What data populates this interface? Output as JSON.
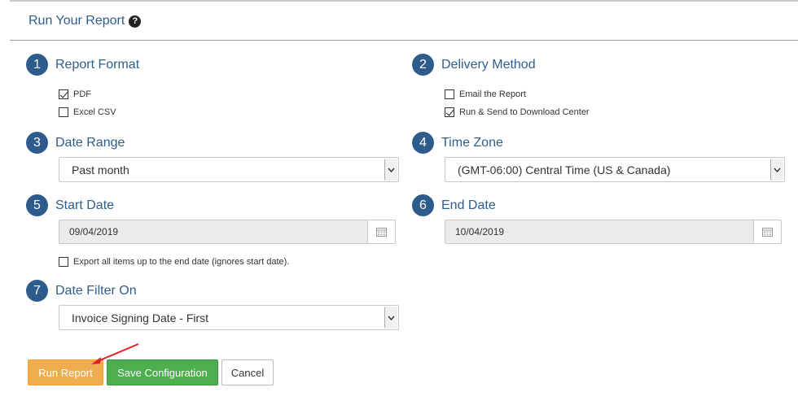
{
  "header": {
    "title": "Run Your Report",
    "help_icon": "question-circle-icon"
  },
  "steps": {
    "s1": {
      "num": "1",
      "title": "Report Format"
    },
    "s2": {
      "num": "2",
      "title": "Delivery Method"
    },
    "s3": {
      "num": "3",
      "title": "Date Range"
    },
    "s4": {
      "num": "4",
      "title": "Time Zone"
    },
    "s5": {
      "num": "5",
      "title": "Start Date"
    },
    "s6": {
      "num": "6",
      "title": "End Date"
    },
    "s7": {
      "num": "7",
      "title": "Date Filter On"
    }
  },
  "report_format": {
    "pdf": {
      "label": "PDF",
      "checked": true
    },
    "csv": {
      "label": "Excel CSV",
      "checked": false
    }
  },
  "delivery": {
    "email": {
      "label": "Email the Report",
      "checked": false
    },
    "download": {
      "label": "Run & Send to Download Center",
      "checked": true
    }
  },
  "date_range": {
    "value": "Past month"
  },
  "time_zone": {
    "value": "(GMT-06:00) Central Time (US & Canada)"
  },
  "start_date": {
    "value": "09/04/2019"
  },
  "end_date": {
    "value": "10/04/2019"
  },
  "export_all": {
    "label": "Export all items up to the end date (ignores start date).",
    "checked": false
  },
  "date_filter": {
    "value": "Invoice Signing Date - First"
  },
  "buttons": {
    "run": "Run Report",
    "save": "Save Configuration",
    "cancel": "Cancel"
  },
  "colors": {
    "accent": "#2d5b8b",
    "run": "#f0ad4e",
    "save": "#4cae4c",
    "annotation": "#e02020"
  }
}
